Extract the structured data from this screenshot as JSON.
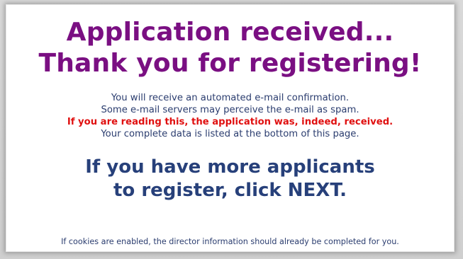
{
  "title": {
    "line1": "Application received...",
    "line2": "Thank you for registering!"
  },
  "message": {
    "line1": "You will receive an automated e-mail confirmation.",
    "line2": "Some e-mail servers may perceive the e-mail as spam.",
    "line3": "If you are reading this, the application was, indeed, received.",
    "line4": "Your complete data is listed at the bottom of this page."
  },
  "cta": {
    "line1": "If you have more applicants",
    "line2": "to register, click NEXT."
  },
  "footnote": "If cookies are enabled, the director information should already be completed for you.",
  "colors": {
    "title": "#7a0f82",
    "body_text": "#2b3d6f",
    "warning": "#e01010",
    "cta": "#27407a"
  }
}
